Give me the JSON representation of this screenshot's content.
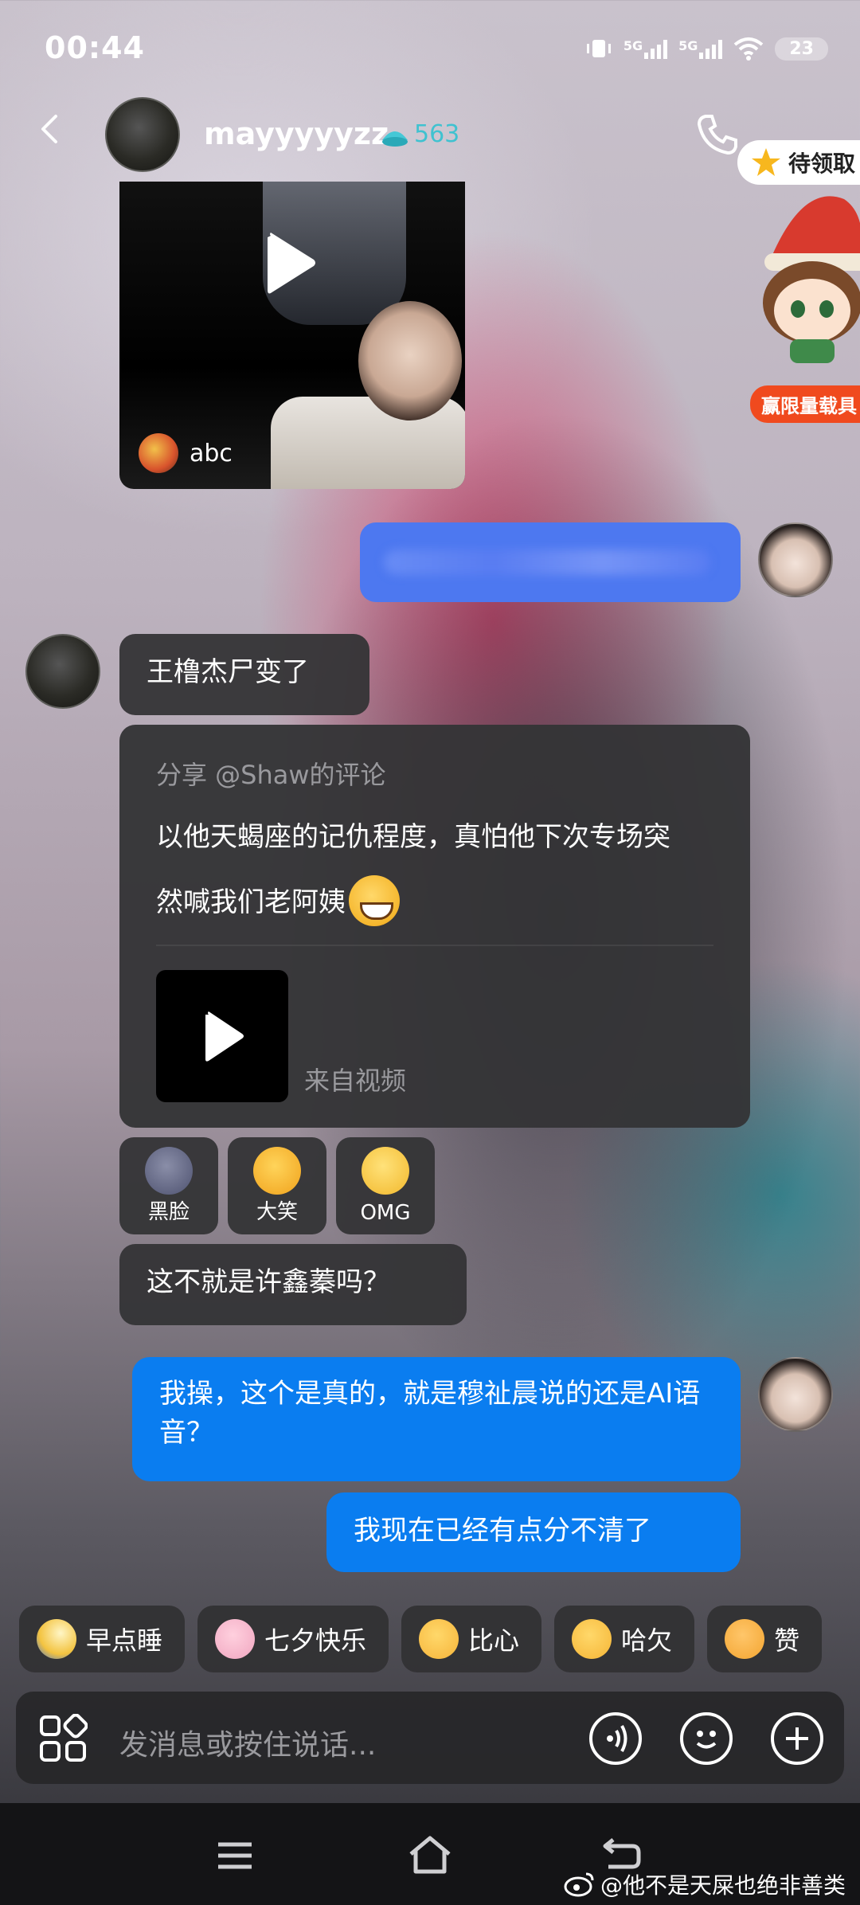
{
  "status_bar": {
    "time": "00:44",
    "network1": "5G",
    "network2": "5G",
    "battery": "23"
  },
  "header": {
    "username": "mayyyyyzz",
    "fire_count": "563",
    "reward_label": "待领取",
    "promo_label": "赢限量载具"
  },
  "video_card": {
    "source_name": "abc"
  },
  "messages": {
    "m1": "王橹杰尸变了",
    "share_title": "分享 @Shaw的评论",
    "share_body_1": "以他天蝎座的记仇程度，真怕他下次专场突",
    "share_body_2": "然喊我们老阿姨",
    "share_source": "来自视频",
    "m2": "这不就是许鑫蓁吗？",
    "m3": "我操，这个是真的，就是穆祉晨说的还是AI语音？",
    "m4": "我现在已经有点分不清了"
  },
  "reactions": [
    {
      "label": "黑脸",
      "icon": "dark-face-icon",
      "color": "#6a6e8a"
    },
    {
      "label": "大笑",
      "icon": "laugh-icon",
      "color": "#f7c02c"
    },
    {
      "label": "OMG",
      "icon": "omg-face-icon",
      "color": "#f9d24a"
    }
  ],
  "quick_replies": [
    {
      "label": "早点睡",
      "icon": "moon-icon",
      "color": "#f3c340"
    },
    {
      "label": "七夕快乐",
      "icon": "magpie-icon",
      "color": "#f0a6c0"
    },
    {
      "label": "比心",
      "icon": "heart-hands-icon",
      "color": "#f6b43a"
    },
    {
      "label": "哈欠",
      "icon": "yawn-face-icon",
      "color": "#f5b536"
    },
    {
      "label": "赞",
      "icon": "thumbs-up-icon",
      "color": "#f3a531"
    }
  ],
  "input": {
    "placeholder": "发消息或按住说话..."
  },
  "watermark": "@他不是天屎也绝非善类"
}
